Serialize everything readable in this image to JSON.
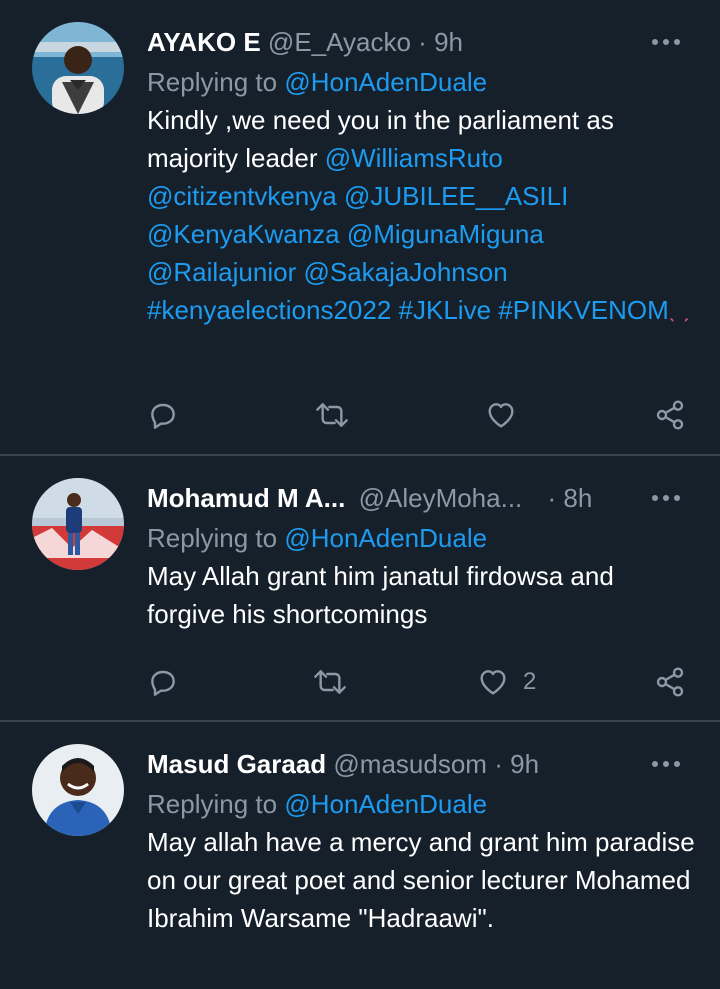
{
  "tweets": [
    {
      "name": "AYAKO E",
      "handle": "@E_Ayacko",
      "sep": "·",
      "time": "9h",
      "replying_label": "Replying to",
      "replying_to": "@HonAdenDuale",
      "text_start": "Kindly ,we need you in the parliament as majority leader",
      "mentions": [
        "@WilliamsRuto",
        "@citizentvkenya",
        "@JUBILEE__ASILI",
        "@KenyaKwanza",
        "@MigunaMiguna",
        "@Railajunior",
        "@SakajaJohnson",
        "#kenyaelections2022",
        "#JKLive",
        "#PINKVENOM"
      ],
      "emoji": "ˎ ˏ",
      "likes": ""
    },
    {
      "name": "Mohamud M A...",
      "handle": "@AleyMoha...",
      "sep": "·",
      "time": "8h",
      "replying_label": "Replying to",
      "replying_to": "@HonAdenDuale",
      "text": "May Allah grant him janatul firdowsa and forgive his shortcomings",
      "likes": "2"
    },
    {
      "name": "Masud Garaad",
      "handle": "@masudsom",
      "sep": "·",
      "time": "9h",
      "replying_label": "Replying to",
      "replying_to": "@HonAdenDuale",
      "text": "May allah have a mercy and grant him paradise on our great poet and senior lecturer Mohamed Ibrahim Warsame \"Hadraawi\"."
    }
  ],
  "icons": {
    "more": "more-dots-icon",
    "reply": "reply-icon",
    "retweet": "retweet-icon",
    "like": "heart-icon",
    "share": "share-icon"
  },
  "colors": {
    "background": "#15202b",
    "link": "#1d9bf0",
    "muted": "#8b98a5",
    "divider": "#38444d"
  }
}
